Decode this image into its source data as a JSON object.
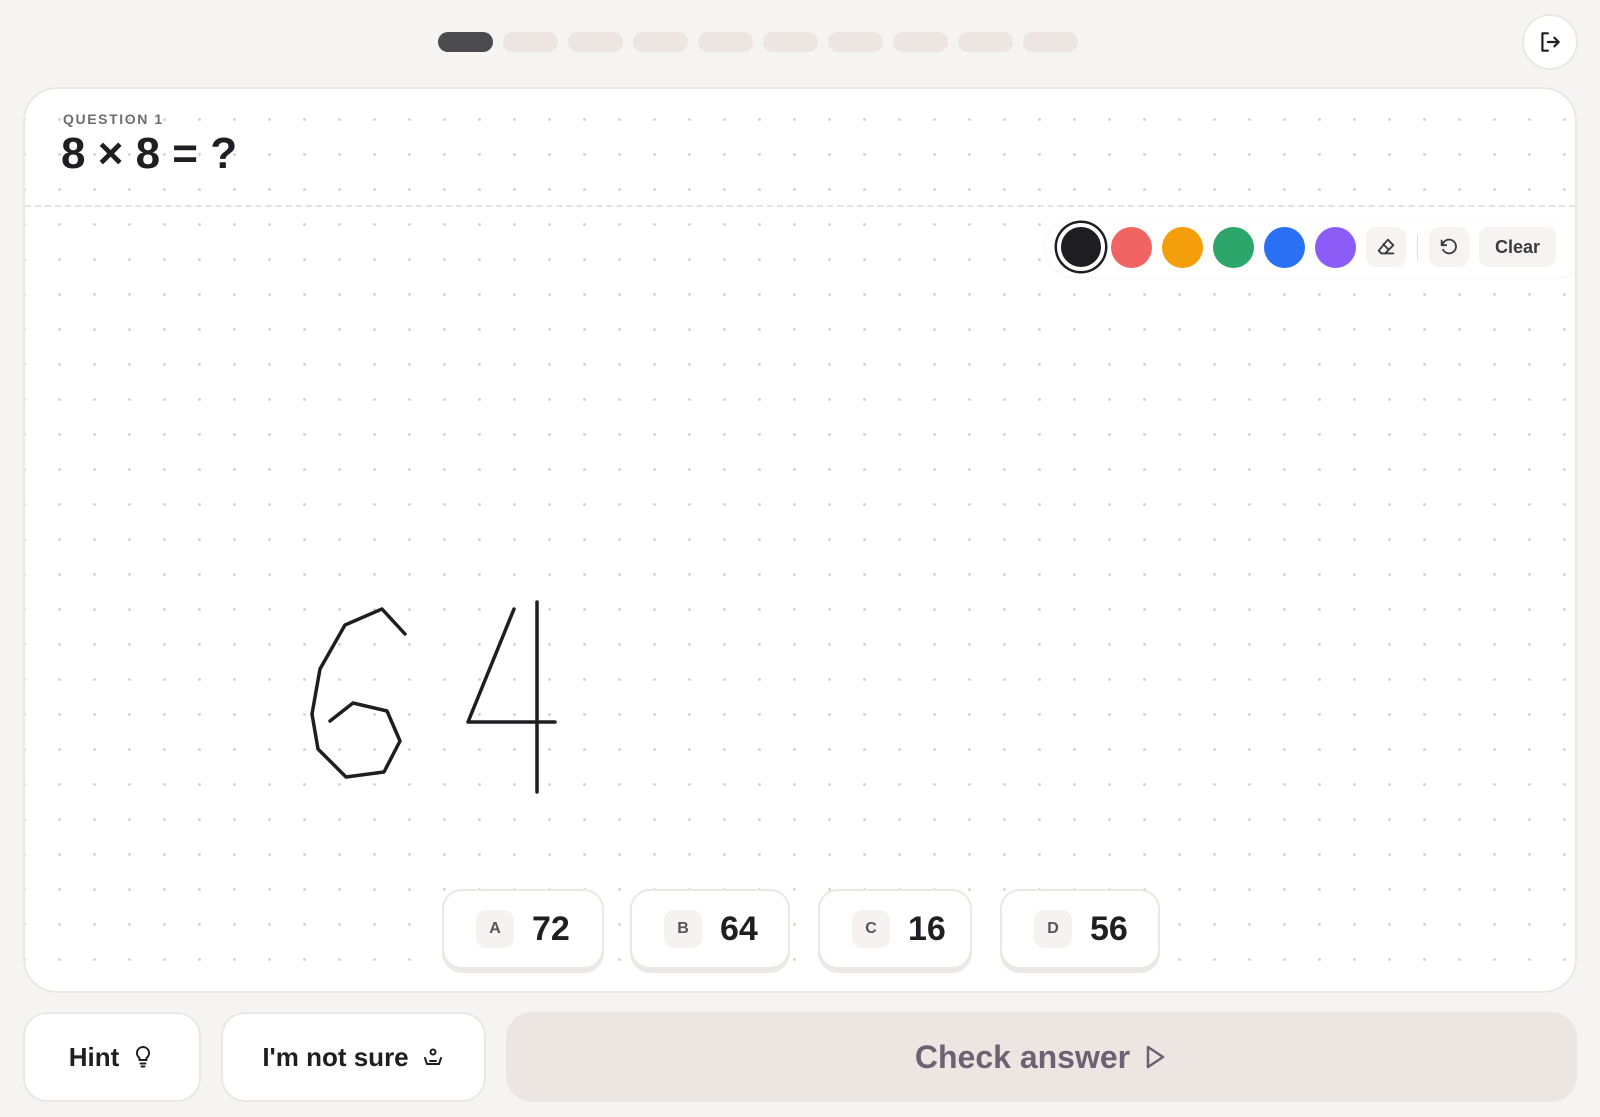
{
  "progress": {
    "total": 10,
    "current": 1
  },
  "question": {
    "label": "QUESTION 1",
    "text": "8 × 8 = ?"
  },
  "toolbar": {
    "colors": [
      "#1e1e22",
      "#f06464",
      "#f59e0b",
      "#2da66b",
      "#2970f5",
      "#8b5cf6"
    ],
    "selected_color": "#1e1e22",
    "eraser_icon": "eraser-icon",
    "undo_icon": "undo-icon",
    "clear_label": "Clear"
  },
  "answers": [
    {
      "letter": "A",
      "value": "72"
    },
    {
      "letter": "B",
      "value": "64"
    },
    {
      "letter": "C",
      "value": "16"
    },
    {
      "letter": "D",
      "value": "56"
    }
  ],
  "actions": {
    "hint_label": "Hint",
    "hint_icon": "lightbulb-icon",
    "unsure_label": "I'm not sure",
    "unsure_icon": "person-icon",
    "check_label": "Check answer",
    "check_icon": "play-icon",
    "exit_icon": "exit-icon"
  },
  "scribble": {
    "color": "#1e1e22",
    "strokes": 3
  }
}
